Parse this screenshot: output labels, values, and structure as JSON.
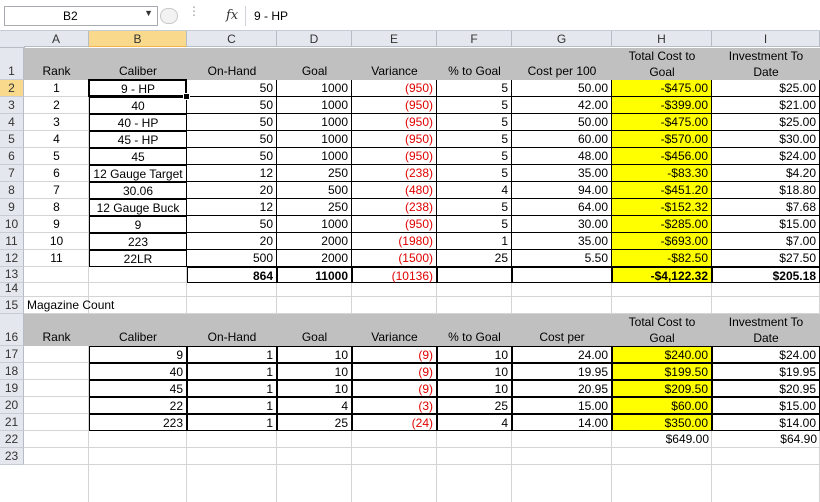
{
  "formula_bar": {
    "name_box": "B2",
    "fx_label": "fx",
    "formula": "9 - HP"
  },
  "columns": [
    "A",
    "B",
    "C",
    "D",
    "E",
    "F",
    "G",
    "H",
    "I"
  ],
  "rows": [
    "1",
    "2",
    "3",
    "4",
    "5",
    "6",
    "7",
    "8",
    "9",
    "10",
    "11",
    "12",
    "13",
    "14",
    "15",
    "16",
    "17",
    "18",
    "19",
    "20",
    "21",
    "22",
    "23"
  ],
  "table1": {
    "headers": {
      "rank": "Rank",
      "caliber": "Caliber",
      "onhand": "On-Hand",
      "goal": "Goal",
      "variance": "Variance",
      "pct": "% to Goal",
      "cost": "Cost per 100",
      "total_l1": "Total Cost to",
      "total_l2": "Goal",
      "invest_l1": "Investment To",
      "invest_l2": "Date"
    },
    "rows": [
      {
        "rank": "1",
        "caliber": "9 - HP",
        "onhand": "50",
        "goal": "1000",
        "variance": "(950)",
        "pct": "5",
        "cost": "50.00",
        "total": "-$475.00",
        "invest": "$25.00"
      },
      {
        "rank": "2",
        "caliber": "40",
        "onhand": "50",
        "goal": "1000",
        "variance": "(950)",
        "pct": "5",
        "cost": "42.00",
        "total": "-$399.00",
        "invest": "$21.00"
      },
      {
        "rank": "3",
        "caliber": "40 - HP",
        "onhand": "50",
        "goal": "1000",
        "variance": "(950)",
        "pct": "5",
        "cost": "50.00",
        "total": "-$475.00",
        "invest": "$25.00"
      },
      {
        "rank": "4",
        "caliber": "45 - HP",
        "onhand": "50",
        "goal": "1000",
        "variance": "(950)",
        "pct": "5",
        "cost": "60.00",
        "total": "-$570.00",
        "invest": "$30.00"
      },
      {
        "rank": "5",
        "caliber": "45",
        "onhand": "50",
        "goal": "1000",
        "variance": "(950)",
        "pct": "5",
        "cost": "48.00",
        "total": "-$456.00",
        "invest": "$24.00"
      },
      {
        "rank": "6",
        "caliber": "12 Gauge Target",
        "onhand": "12",
        "goal": "250",
        "variance": "(238)",
        "pct": "5",
        "cost": "35.00",
        "total": "-$83.30",
        "invest": "$4.20"
      },
      {
        "rank": "7",
        "caliber": "30.06",
        "onhand": "20",
        "goal": "500",
        "variance": "(480)",
        "pct": "4",
        "cost": "94.00",
        "total": "-$451.20",
        "invest": "$18.80"
      },
      {
        "rank": "8",
        "caliber": "12 Gauge Buck",
        "onhand": "12",
        "goal": "250",
        "variance": "(238)",
        "pct": "5",
        "cost": "64.00",
        "total": "-$152.32",
        "invest": "$7.68"
      },
      {
        "rank": "9",
        "caliber": "9",
        "onhand": "50",
        "goal": "1000",
        "variance": "(950)",
        "pct": "5",
        "cost": "30.00",
        "total": "-$285.00",
        "invest": "$15.00"
      },
      {
        "rank": "10",
        "caliber": "223",
        "onhand": "20",
        "goal": "2000",
        "variance": "(1980)",
        "pct": "1",
        "cost": "35.00",
        "total": "-$693.00",
        "invest": "$7.00"
      },
      {
        "rank": "11",
        "caliber": "22LR",
        "onhand": "500",
        "goal": "2000",
        "variance": "(1500)",
        "pct": "25",
        "cost": "5.50",
        "total": "-$82.50",
        "invest": "$27.50"
      }
    ],
    "totals": {
      "onhand": "864",
      "goal": "11000",
      "variance": "(10136)",
      "total": "-$4,122.32",
      "invest": "$205.18"
    }
  },
  "section_label": "Magazine Count",
  "table2": {
    "headers": {
      "rank": "Rank",
      "caliber": "Caliber",
      "onhand": "On-Hand",
      "goal": "Goal",
      "variance": "Variance",
      "pct": "% to Goal",
      "cost": "Cost per",
      "total_l1": "Total Cost to",
      "total_l2": "Goal",
      "invest_l1": "Investment To",
      "invest_l2": "Date"
    },
    "rows": [
      {
        "caliber": "9",
        "onhand": "1",
        "goal": "10",
        "variance": "(9)",
        "pct": "10",
        "cost": "24.00",
        "total": "$240.00",
        "invest": "$24.00"
      },
      {
        "caliber": "40",
        "onhand": "1",
        "goal": "10",
        "variance": "(9)",
        "pct": "10",
        "cost": "19.95",
        "total": "$199.50",
        "invest": "$19.95"
      },
      {
        "caliber": "45",
        "onhand": "1",
        "goal": "10",
        "variance": "(9)",
        "pct": "10",
        "cost": "20.95",
        "total": "$209.50",
        "invest": "$20.95"
      },
      {
        "caliber": "22",
        "onhand": "1",
        "goal": "4",
        "variance": "(3)",
        "pct": "25",
        "cost": "15.00",
        "total": "$60.00",
        "invest": "$15.00"
      },
      {
        "caliber": "223",
        "onhand": "1",
        "goal": "25",
        "variance": "(24)",
        "pct": "4",
        "cost": "14.00",
        "total": "$350.00",
        "invest": "$14.00"
      }
    ],
    "totals": {
      "total": "$649.00",
      "invest": "$64.90"
    }
  }
}
